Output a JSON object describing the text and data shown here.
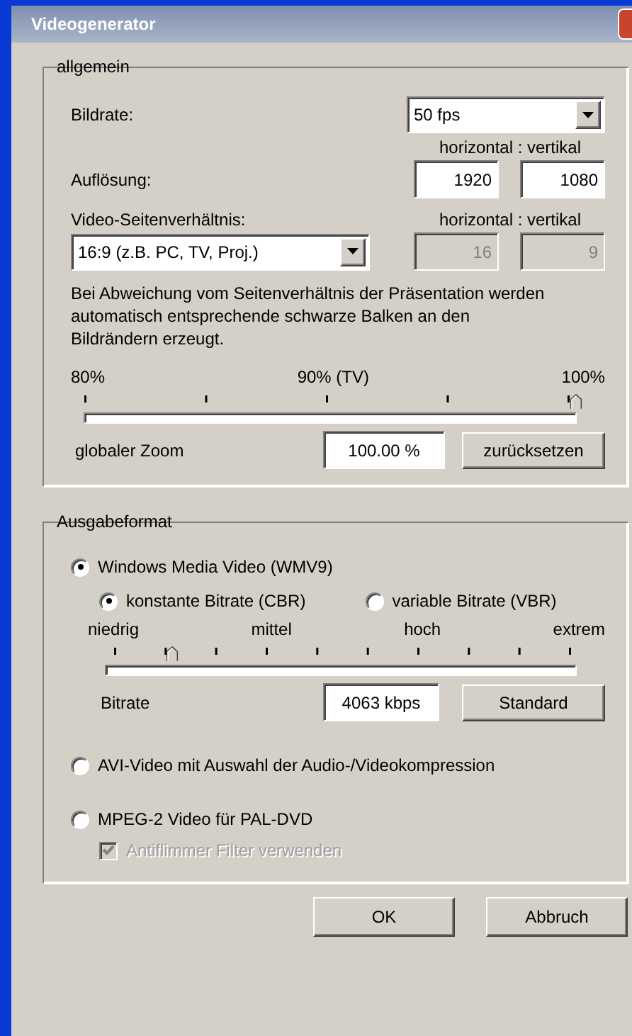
{
  "window": {
    "title": "Videogenerator"
  },
  "general": {
    "legend": "allgemein",
    "frame_rate": {
      "label": "Bildrate:",
      "value": "50 fps"
    },
    "resolution": {
      "header": "horizontal : vertikal",
      "label": "Auflösung:",
      "horizontal": "1920",
      "vertical": "1080"
    },
    "aspect": {
      "label": "Video-Seitenverhältnis:",
      "header": "horizontal : vertikal",
      "value": "16:9 (z.B. PC, TV, Proj.)",
      "horizontal": "16",
      "vertical": "9",
      "disabled": true
    },
    "note": "Bei Abweichung vom Seitenverhältnis der Präsentation werden automatisch entsprechende schwarze Balken an den Bildrändern erzeugt.",
    "zoom": {
      "ticks": [
        "80%",
        "90% (TV)",
        "100%"
      ],
      "level": 1,
      "label": "globaler Zoom",
      "value": "100.00 %",
      "button": "zurücksetzen"
    }
  },
  "output": {
    "legend": "Ausgabeformat",
    "formats": [
      {
        "label": "Windows Media Video (WMV9)",
        "selected": true
      },
      {
        "label": "AVI-Video mit Auswahl der Audio-/Videokompression",
        "selected": false
      },
      {
        "label": "MPEG-2 Video für PAL-DVD",
        "selected": false
      }
    ],
    "bitrate_modes": [
      {
        "label": "konstante Bitrate (CBR)",
        "selected": true
      },
      {
        "label": "variable Bitrate (VBR)",
        "selected": false
      }
    ],
    "bitrate": {
      "ticks": [
        "niedrig",
        "mittel",
        "hoch",
        "extrem"
      ],
      "level": 0.14,
      "label": "Bitrate",
      "value": "4063 kbps",
      "button": "Standard"
    },
    "antiflicker": {
      "label": "Antiflimmer Filter verwenden",
      "checked": true,
      "disabled": true
    }
  },
  "buttons": [
    "OK",
    "Abbruch"
  ]
}
